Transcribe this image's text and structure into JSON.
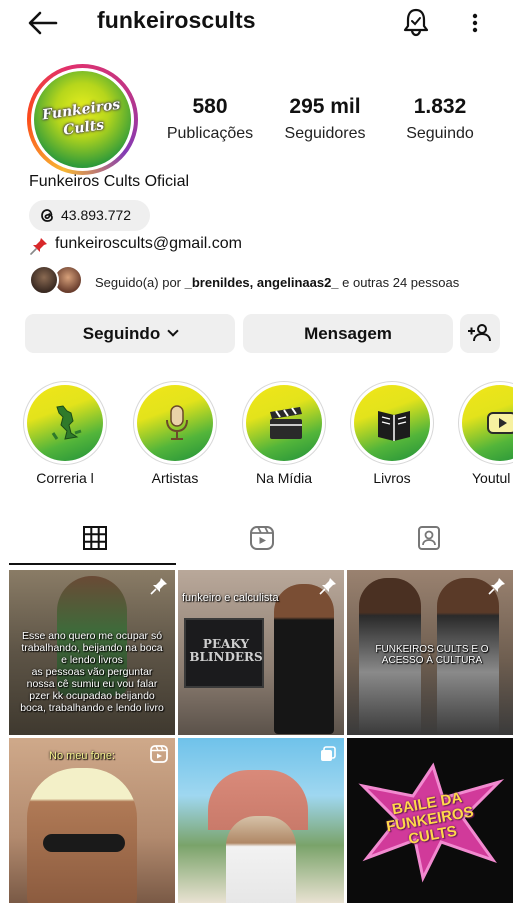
{
  "header": {
    "username": "funkeiroscults"
  },
  "profile": {
    "avatar_text": "Funkeiros Cults",
    "stats": [
      {
        "value": "580",
        "label": "Publicações"
      },
      {
        "value": "295 mil",
        "label": "Seguidores"
      },
      {
        "value": "1.832",
        "label": "Seguindo"
      }
    ],
    "display_name": "Funkeiros Cults Oficial",
    "threads_count": "43.893.772",
    "email": "funkeiroscults@gmail.com",
    "followed_by_prefix": "Seguido(a) por ",
    "followed_by_names": "_brenildes, angelinaas2_",
    "followed_by_suffix": " e outras 24 pessoas"
  },
  "actions": {
    "following_label": "Seguindo",
    "message_label": "Mensagem"
  },
  "highlights": [
    {
      "label": "Correria l",
      "icon": "crocodile-icon"
    },
    {
      "label": "Artistas",
      "icon": "microphone-icon"
    },
    {
      "label": "Na Mídia",
      "icon": "clapperboard-icon"
    },
    {
      "label": "Livros",
      "icon": "book-icon"
    },
    {
      "label": "Youtul",
      "icon": "youtube-icon"
    }
  ],
  "tabs": [
    {
      "name": "grid",
      "icon": "grid-icon",
      "active": true
    },
    {
      "name": "reels",
      "icon": "reels-icon",
      "active": false
    },
    {
      "name": "tagged",
      "icon": "tagged-icon",
      "active": false
    }
  ],
  "posts": [
    {
      "caption": "Esse ano quero me ocupar só trabalhando, beijando na boca e lendo livros\nas pessoas vão perguntar nossa cê sumiu eu vou falar pzer kk ocupadao beijando boca, trabalhando e lendo livro",
      "badge": "pin-icon"
    },
    {
      "caption": "funkeiro e calculista",
      "inner_text": "PEAKY BLINDERS",
      "badge": "pin-icon"
    },
    {
      "caption": "FUNKEIROS CULTS E O ACESSO À CULTURA",
      "badge": "pin-icon"
    },
    {
      "caption": "No meu fone:",
      "badge": "reels-icon"
    },
    {
      "caption": "",
      "badge": "multi-icon"
    },
    {
      "caption": "BAILE DA FUNKEIROS CULTS",
      "badge": ""
    }
  ],
  "colors": {
    "button_bg": "#efefef",
    "highlight_yellow": "#f1e61a",
    "highlight_green": "#1f8f3a"
  }
}
